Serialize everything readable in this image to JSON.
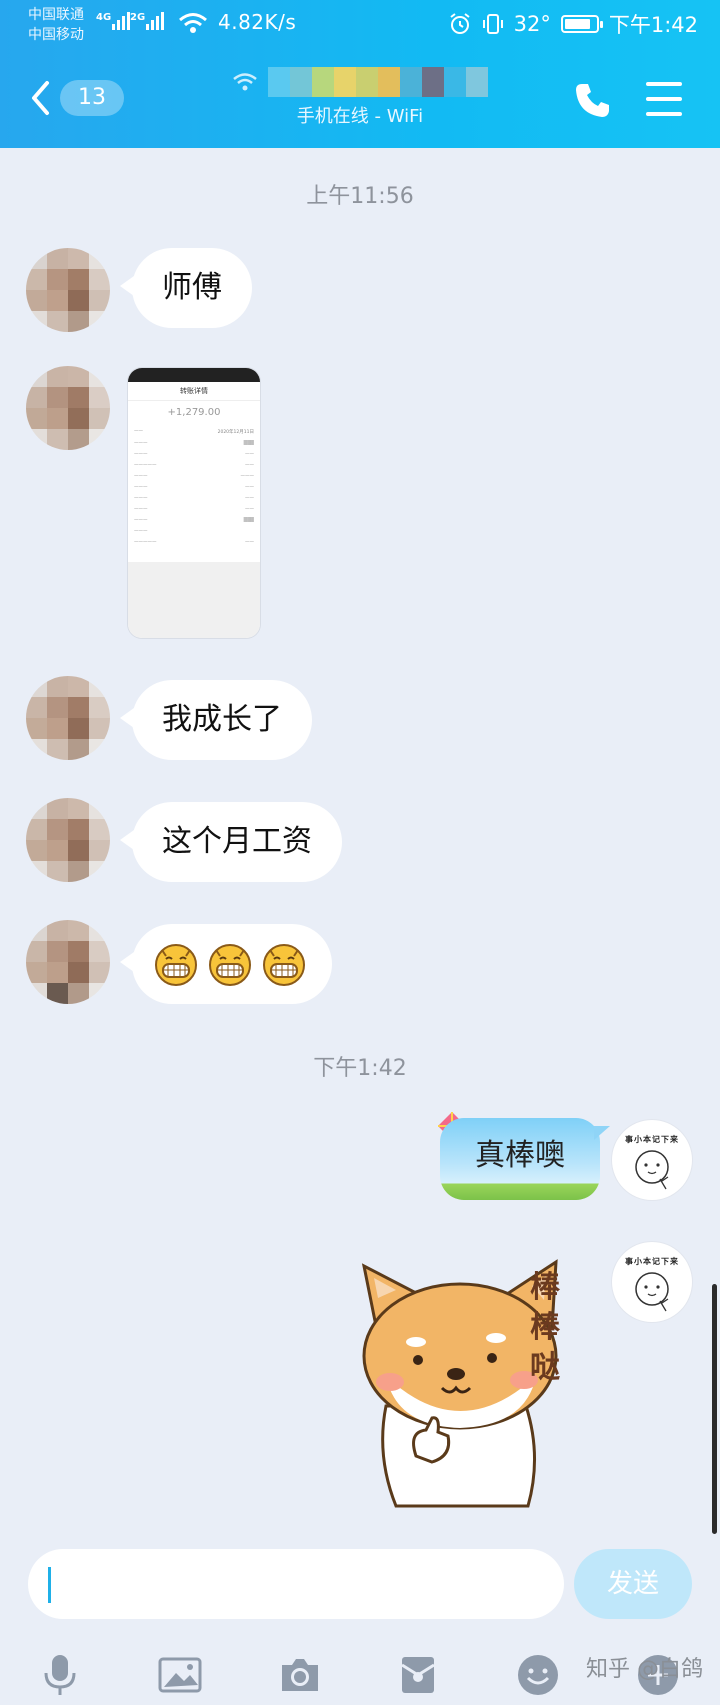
{
  "status_bar": {
    "carrier_1": "中国联通",
    "carrier_2": "中国移动",
    "net_1": "4G",
    "net_2": "2G",
    "speed": "4.82K/s",
    "battery_temp": "32°",
    "time": "下午1:42",
    "battery_level": 0.85
  },
  "header": {
    "unread_badge": "13",
    "subtitle": "手机在线 - WiFi",
    "accent": "#1ab4f2"
  },
  "messages": {
    "time_1": "上午11:56",
    "msg_1": "师傅",
    "msg_3": "我成长了",
    "msg_4": "这个月工资",
    "time_2": "下午1:42",
    "reply_1": "真棒噢",
    "sticker_text": "棒棒哒",
    "avatar_caption": "事小本记下来"
  },
  "receipt_image": {
    "header": "转账详情",
    "amount": "+1,279.00",
    "date": "2020年12月11日"
  },
  "input": {
    "placeholder": "",
    "send_label": "发送"
  },
  "toolbar_icons": [
    "microphone-icon",
    "image-icon",
    "camera-icon",
    "red-packet-icon",
    "emoji-icon",
    "plus-icon"
  ],
  "watermark": "知乎 @白鸽"
}
